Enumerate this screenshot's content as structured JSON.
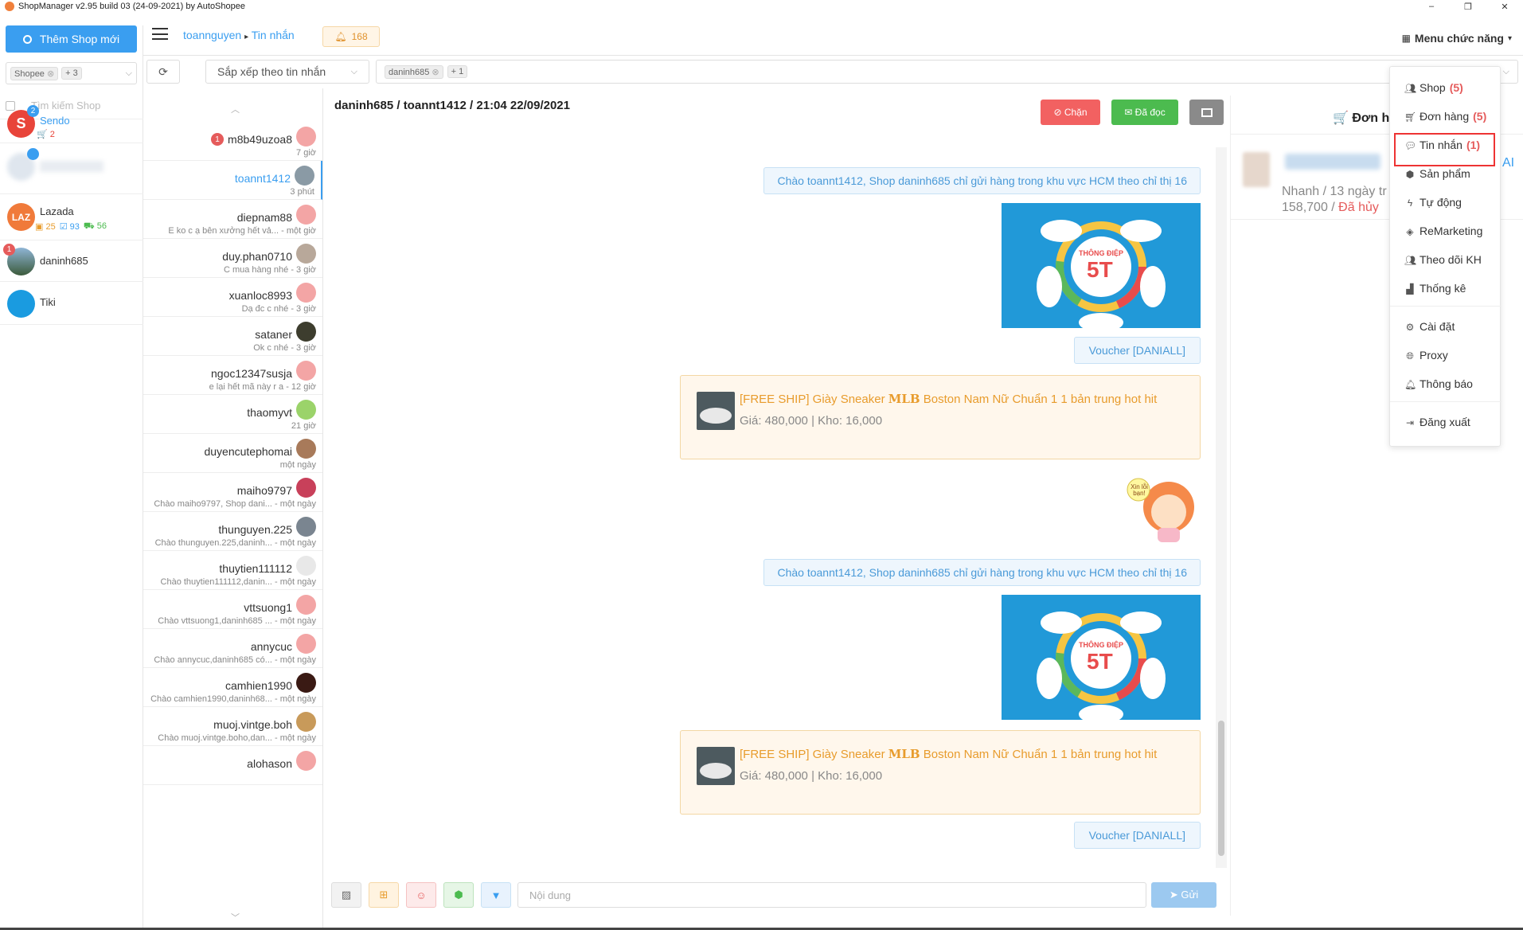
{
  "app": {
    "title": "ShopManager v2.95 build 03 (24-09-2021) by AutoShopee",
    "win_minimize": "–",
    "win_restore": "❐",
    "win_close": "✕"
  },
  "sidebar": {
    "add_shop_label": "Thêm Shop mới",
    "filter_tag": "Shopee",
    "filter_more": "+ 3",
    "search_placeholder": "Tìm kiếm Shop",
    "shops": [
      {
        "name": "Sendo",
        "badge": "2",
        "stats": "🛒 2",
        "color": "#e8443a"
      },
      {
        "name": "",
        "badge": "",
        "stats": "",
        "color": "#cfd8e3"
      },
      {
        "name": "Lazada",
        "badge": "",
        "stats_a": "25",
        "stats_b": "93",
        "stats_c": "56",
        "color": "#f07a3a"
      },
      {
        "name": "daninh685",
        "badge": "1",
        "stats": "",
        "color": "#4a6b8a"
      },
      {
        "name": "Tiki",
        "badge": "",
        "stats": "",
        "color": "#1a9be0"
      }
    ]
  },
  "header": {
    "breadcrumb_user": "toannguyen",
    "breadcrumb_sep": "▸",
    "breadcrumb_page": "Tin nhắn",
    "notif_count": "168",
    "menu_label": "Menu chức năng"
  },
  "toolbar": {
    "sort_label": "Sắp xếp theo tin nhắn",
    "filter_tag": "daninh685",
    "filter_more": "+ 1"
  },
  "conversations": [
    {
      "name": "m8b49uzoa8",
      "sub": "7 giờ",
      "unread": "1",
      "avatar_color": "#f3a5a5"
    },
    {
      "name": "toannt1412",
      "sub": "3 phút",
      "unread": "",
      "avatar_color": "#8a9aa5"
    },
    {
      "name": "diepnam88",
      "sub": "E ko c ạ bên xưởng hết vả... - một giờ",
      "unread": "",
      "avatar_color": "#f3a5a5"
    },
    {
      "name": "duy.phan0710",
      "sub": "C mua hàng nhé - 3 giờ",
      "unread": "",
      "avatar_color": "#b8a89a"
    },
    {
      "name": "xuanloc8993",
      "sub": "Dạ đc c nhé - 3 giờ",
      "unread": "",
      "avatar_color": "#f3a5a5"
    },
    {
      "name": "sataner",
      "sub": "Ok c nhé - 3 giờ",
      "unread": "",
      "avatar_color": "#3d3d2e"
    },
    {
      "name": "ngoc12347susja",
      "sub": "e lại hết mã này r a - 12 giờ",
      "unread": "",
      "avatar_color": "#f3a5a5"
    },
    {
      "name": "thaomyvt",
      "sub": "21 giờ",
      "unread": "",
      "avatar_color": "#9bd36a"
    },
    {
      "name": "duyencutephomai",
      "sub": "một ngày",
      "unread": "",
      "avatar_color": "#a87a5a"
    },
    {
      "name": "maiho9797",
      "sub": "Chào maiho9797, Shop dani... - một ngày",
      "unread": "",
      "avatar_color": "#c8405a"
    },
    {
      "name": "thunguyen.225",
      "sub": "Chào thunguyen.225,daninh... - một ngày",
      "unread": "",
      "avatar_color": "#7a8590"
    },
    {
      "name": "thuytien111112",
      "sub": "Chào thuytien111112,danin... - một ngày",
      "unread": "",
      "avatar_color": "#e8e8e8"
    },
    {
      "name": "vttsuong1",
      "sub": "Chào vttsuong1,daninh685 ... - một ngày",
      "unread": "",
      "avatar_color": "#f3a5a5"
    },
    {
      "name": "annycuc",
      "sub": "Chào annycuc,daninh685 có... - một ngày",
      "unread": "",
      "avatar_color": "#f3a5a5"
    },
    {
      "name": "camhien1990",
      "sub": "Chào camhien1990,daninh68... - một ngày",
      "unread": "",
      "avatar_color": "#3a1a14"
    },
    {
      "name": "muoj.vintge.boh",
      "sub": "Chào muoj.vintge.boho,dan... - một ngày",
      "unread": "",
      "avatar_color": "#c89a5a"
    },
    {
      "name": "alohason",
      "sub": "",
      "unread": "",
      "avatar_color": "#f3a5a5"
    }
  ],
  "chat": {
    "title": "daninh685 / toannt1412 / 21:04 22/09/2021",
    "block_label": "⊘ Chặn",
    "read_label": "✉ Đã đọc",
    "greeting": "Chào toannt1412, Shop daninh685 chỉ gửi hàng trong khu vực HCM theo chỉ thị 16",
    "voucher": "Voucher [DANIALL]",
    "product_title_a": "[FREE SHIP] Giày Sneaker ",
    "product_title_brand": "MLB",
    "product_title_b": " Boston Nam Nữ Chuẩn 1 1 bản trung hot hit",
    "product_meta": "Giá: 480,000 | Kho: 16,000",
    "img_label": "THÔNG ĐIỆP",
    "img_big": "5T",
    "sticker_text": "Xin lỗi bạn!"
  },
  "composer": {
    "placeholder": "Nội dung",
    "send_label": "➤ Gửi"
  },
  "order_panel": {
    "title": "🛒 Đơn hà",
    "line1": "Nhanh / 13 ngày tr",
    "line2_price": "158,700 / ",
    "line2_status": "Đã hủy",
    "ai_text": "AI"
  },
  "func_menu": {
    "items": [
      {
        "label": "Shop",
        "count": "(5)",
        "icon": "users-icon"
      },
      {
        "label": "Đơn hàng",
        "count": "(5)",
        "icon": "cart-icon"
      },
      {
        "label": "Tin nhắn",
        "count": "(1)",
        "icon": "comment-icon"
      },
      {
        "label": "Sản phẩm",
        "count": "",
        "icon": "cubes-icon"
      },
      {
        "label": "Tự động",
        "count": "",
        "icon": "bolt-icon"
      },
      {
        "label": "ReMarketing",
        "count": "",
        "icon": "diamond-icon"
      },
      {
        "label": "Theo dõi KH",
        "count": "",
        "icon": "users-icon"
      },
      {
        "label": "Thống kê",
        "count": "",
        "icon": "chart-icon"
      },
      {
        "label": "Cài đặt",
        "count": "",
        "icon": "gear-icon"
      },
      {
        "label": "Proxy",
        "count": "",
        "icon": "globe-icon"
      },
      {
        "label": "Thông báo",
        "count": "",
        "icon": "bell-icon"
      },
      {
        "label": "Đăng xuất",
        "count": "",
        "icon": "signout-icon"
      }
    ]
  },
  "colors": {
    "primary": "#3a9ef0",
    "danger": "#f26161",
    "success": "#4cbb4f",
    "warning": "#e89c2d"
  }
}
